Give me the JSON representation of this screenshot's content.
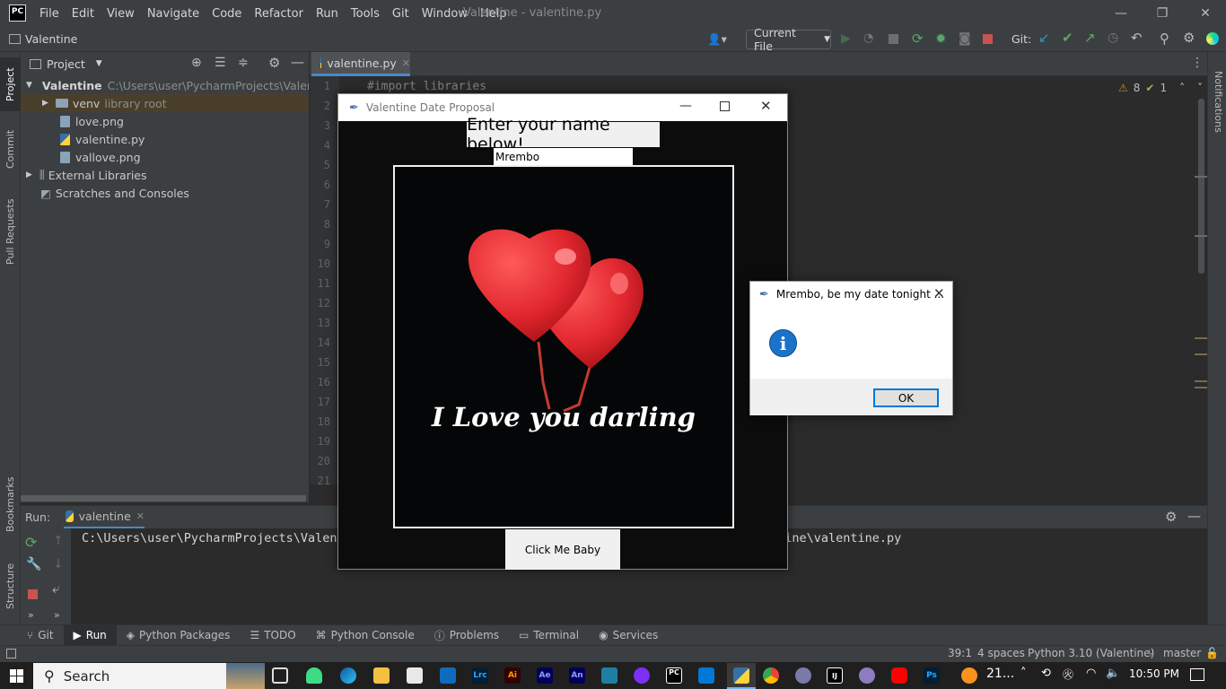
{
  "titlebar": {
    "logo": "PC",
    "menu": [
      "File",
      "Edit",
      "View",
      "Navigate",
      "Code",
      "Refactor",
      "Run",
      "Tools",
      "Git",
      "Window",
      "Help"
    ],
    "window_title": "Valentine - valentine.py"
  },
  "navbar": {
    "project": "Valentine",
    "run_config": "Current File",
    "git_label": "Git:"
  },
  "left_stripe": {
    "tabs": [
      "Project",
      "Commit",
      "Pull Requests",
      "Bookmarks",
      "Structure"
    ]
  },
  "right_stripe": {
    "tabs": [
      "Notifications"
    ]
  },
  "project_panel": {
    "title": "Project",
    "root_name": "Valentine",
    "root_path": "C:\\Users\\user\\PycharmProjects\\Valentine",
    "venv": "venv",
    "venv_note": "library root",
    "files": [
      "love.png",
      "valentine.py",
      "vallove.png"
    ],
    "external": "External Libraries",
    "scratches": "Scratches and Consoles"
  },
  "editor": {
    "tab": "valentine.py",
    "line_numbers": [
      "1",
      "2",
      "3",
      "4",
      "5",
      "6",
      "7",
      "8",
      "9",
      "10",
      "11",
      "12",
      "13",
      "14",
      "15",
      "16",
      "17",
      "18",
      "19",
      "20",
      "21"
    ],
    "first_line": "#import libraries",
    "warnings": "8",
    "weak_warnings": "1"
  },
  "run_panel": {
    "label": "Run:",
    "tab": "valentine",
    "output_left": "C:\\Users\\user\\PycharmProjects\\Valent",
    "output_right": "ntine\\valentine.py"
  },
  "tool_tabs": [
    "Git",
    "Run",
    "Python Packages",
    "TODO",
    "Python Console",
    "Problems",
    "Terminal",
    "Services"
  ],
  "status": {
    "position": "39:1",
    "indent": "4 spaces",
    "interpreter": "Python 3.10 (Valentine)",
    "branch": "master"
  },
  "taskbar": {
    "search": "Search",
    "weather": "21...",
    "time": "10:50 PM"
  },
  "tk_window": {
    "title": "Valentine Date Proposal",
    "label": "Enter your name below!",
    "entry_value": "Mrembo",
    "image_caption": "I Love you darling",
    "button": "Click Me Baby"
  },
  "message_box": {
    "title": "Mrembo, be my date tonight ...",
    "ok": "OK"
  },
  "colors": {
    "ide_bg": "#2b2b2b",
    "panel_bg": "#3c3f41",
    "accent_blue": "#0078d7",
    "heart_red": "#e0262e"
  }
}
